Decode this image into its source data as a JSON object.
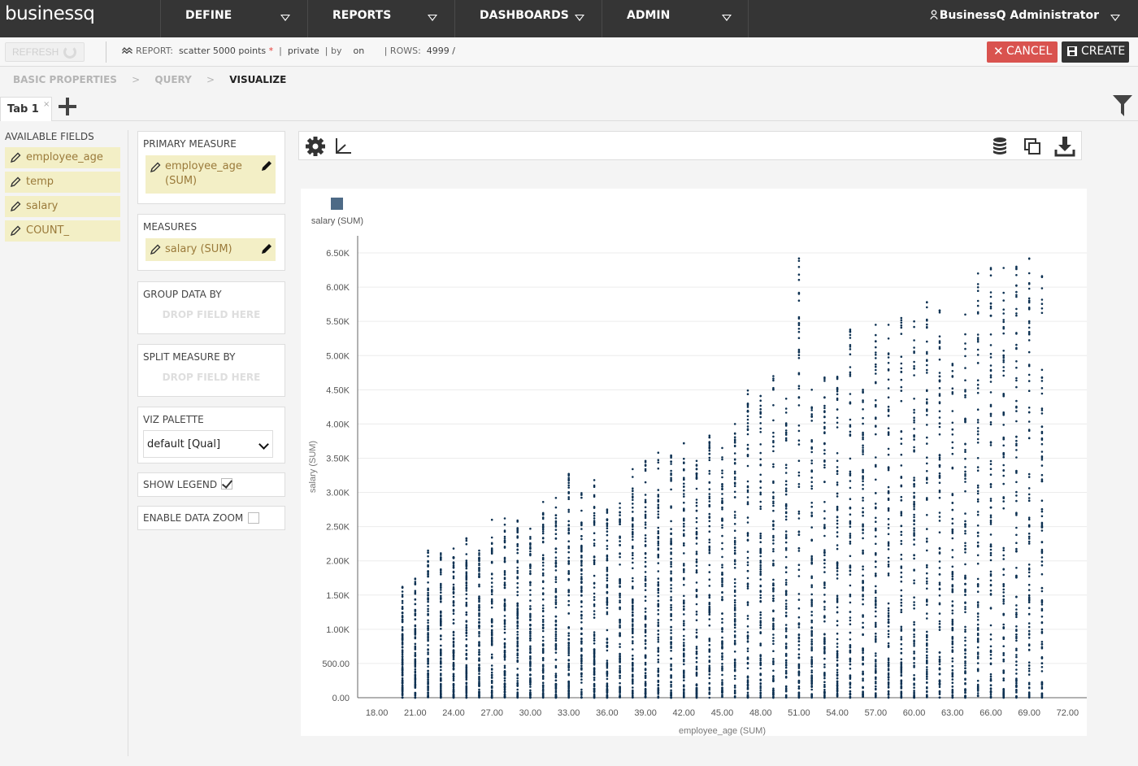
{
  "app": {
    "logo": "businessq",
    "nav": [
      {
        "label": "DEFINE"
      },
      {
        "label": "REPORTS"
      },
      {
        "label": "DASHBOARDS"
      },
      {
        "label": "ADMIN"
      }
    ],
    "user": "BusinessQ Administrator"
  },
  "toolbar": {
    "refresh_label": "REFRESH",
    "report_prefix": "REPORT:",
    "report_name": "scatter 5000 points",
    "required_mark": "*",
    "sep": "|",
    "visibility": "private",
    "by_label": "by",
    "on_label": "on",
    "rows_label": "ROWS:",
    "rows_value": "4999 /",
    "cancel_label": "CANCEL",
    "create_label": "CREATE"
  },
  "wizard": {
    "steps": [
      "BASIC PROPERTIES",
      "QUERY",
      "VISUALIZE"
    ],
    "separator": ">"
  },
  "tabs": [
    {
      "label": "Tab 1",
      "close": "×"
    }
  ],
  "available_fields": {
    "title": "AVAILABLE FIELDS",
    "items": [
      "employee_age",
      "temp",
      "salary",
      "COUNT_"
    ]
  },
  "config": {
    "primary_measure": {
      "title": "PRIMARY MEASURE",
      "field_line1": "employee_age",
      "field_line2": "(SUM)"
    },
    "measures": {
      "title": "MEASURES",
      "field": "salary (SUM)"
    },
    "group_by": {
      "title": "GROUP DATA BY",
      "drop": "DROP FIELD HERE"
    },
    "split_by": {
      "title": "SPLIT MEASURE BY",
      "drop": "DROP FIELD HERE"
    },
    "palette": {
      "title": "VIZ PALETTE",
      "selected": "default [Qual]"
    },
    "show_legend": {
      "label": "SHOW LEGEND",
      "checked": true
    },
    "data_zoom": {
      "label": "ENABLE DATA ZOOM",
      "checked": false
    }
  },
  "colors": {
    "point": "#0d3152",
    "legend": "#4d6a86",
    "accent_red": "#d9534f"
  },
  "chart_data": {
    "type": "scatter",
    "xlabel": "employee_age (SUM)",
    "ylabel": "salary (SUM)",
    "legend": [
      {
        "name": "salary (SUM)"
      }
    ],
    "legend_position": "top-left",
    "xlim": [
      16.5,
      73.5
    ],
    "ylim": [
      0,
      6750
    ],
    "x_ticks": [
      "18.00",
      "21.00",
      "24.00",
      "27.00",
      "30.00",
      "33.00",
      "36.00",
      "39.00",
      "42.00",
      "45.00",
      "48.00",
      "51.00",
      "54.00",
      "57.00",
      "60.00",
      "63.00",
      "66.00",
      "69.00",
      "72.00"
    ],
    "x_tick_values": [
      18,
      21,
      24,
      27,
      30,
      33,
      36,
      39,
      42,
      45,
      48,
      51,
      54,
      57,
      60,
      63,
      66,
      69,
      72
    ],
    "y_ticks": [
      "0.00",
      "500.00",
      "1.00K",
      "1.50K",
      "2.00K",
      "2.50K",
      "3.00K",
      "3.50K",
      "4.00K",
      "4.50K",
      "5.00K",
      "5.50K",
      "6.00K",
      "6.50K"
    ],
    "y_tick_values": [
      0,
      500,
      1000,
      1500,
      2000,
      2500,
      3000,
      3500,
      4000,
      4500,
      5000,
      5500,
      6000,
      6500
    ],
    "grid": true,
    "point_count": 4999,
    "x_range": [
      20,
      70
    ],
    "x_step": 1,
    "max_salary_by_age": [
      [
        20,
        1620
      ],
      [
        21,
        1740
      ],
      [
        22,
        2150
      ],
      [
        23,
        2110
      ],
      [
        24,
        2180
      ],
      [
        25,
        2330
      ],
      [
        26,
        2150
      ],
      [
        27,
        2600
      ],
      [
        28,
        2620
      ],
      [
        29,
        2590
      ],
      [
        30,
        2470
      ],
      [
        31,
        2860
      ],
      [
        32,
        2920
      ],
      [
        33,
        3270
      ],
      [
        34,
        2990
      ],
      [
        35,
        3180
      ],
      [
        36,
        2750
      ],
      [
        37,
        2840
      ],
      [
        38,
        3340
      ],
      [
        39,
        3460
      ],
      [
        40,
        3580
      ],
      [
        41,
        3540
      ],
      [
        42,
        3720
      ],
      [
        43,
        3460
      ],
      [
        44,
        3830
      ],
      [
        45,
        3650
      ],
      [
        46,
        4000
      ],
      [
        47,
        4490
      ],
      [
        48,
        4410
      ],
      [
        49,
        4700
      ],
      [
        50,
        4370
      ],
      [
        51,
        6420
      ],
      [
        52,
        4500
      ],
      [
        53,
        4680
      ],
      [
        54,
        4690
      ],
      [
        55,
        5380
      ],
      [
        56,
        4500
      ],
      [
        57,
        5450
      ],
      [
        58,
        5450
      ],
      [
        59,
        5550
      ],
      [
        60,
        5500
      ],
      [
        61,
        5780
      ],
      [
        62,
        5660
      ],
      [
        63,
        4880
      ],
      [
        64,
        5600
      ],
      [
        65,
        6200
      ],
      [
        66,
        6280
      ],
      [
        67,
        6280
      ],
      [
        68,
        6300
      ],
      [
        69,
        6420
      ],
      [
        70,
        6160
      ]
    ]
  }
}
